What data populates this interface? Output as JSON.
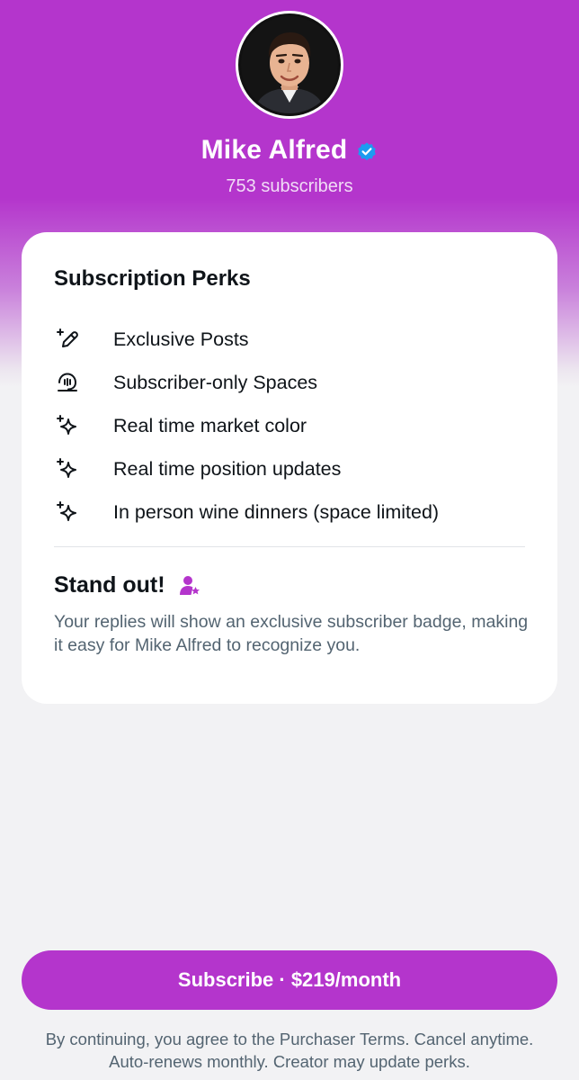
{
  "profile": {
    "name": "Mike Alfred",
    "subscribers": "753 subscribers",
    "verified": true
  },
  "card": {
    "title": "Subscription Perks",
    "perks": [
      {
        "icon": "pencil-sparkle-icon",
        "label": "Exclusive Posts"
      },
      {
        "icon": "spaces-icon",
        "label": "Subscriber-only Spaces"
      },
      {
        "icon": "sparkle-icon",
        "label": "Real time market color"
      },
      {
        "icon": "sparkle-icon",
        "label": "Real time position updates"
      },
      {
        "icon": "sparkle-icon",
        "label": "In person wine dinners (space limited)"
      }
    ],
    "standout_title": "Stand out!",
    "standout_icon": "subscriber-badge-icon",
    "standout_desc": "Your replies will show an exclusive subscriber badge, making it easy for Mike Alfred to recognize you."
  },
  "subscribe_button": {
    "label": "Subscribe · $219/month"
  },
  "legal_text": "By continuing, you agree to the Purchaser Terms. Cancel anytime. Auto-renews monthly. Creator may update perks.",
  "colors": {
    "accent": "#b435cc",
    "verified_blue": "#1d9bf0",
    "text": "#0f1419",
    "secondary_text": "#536471"
  }
}
